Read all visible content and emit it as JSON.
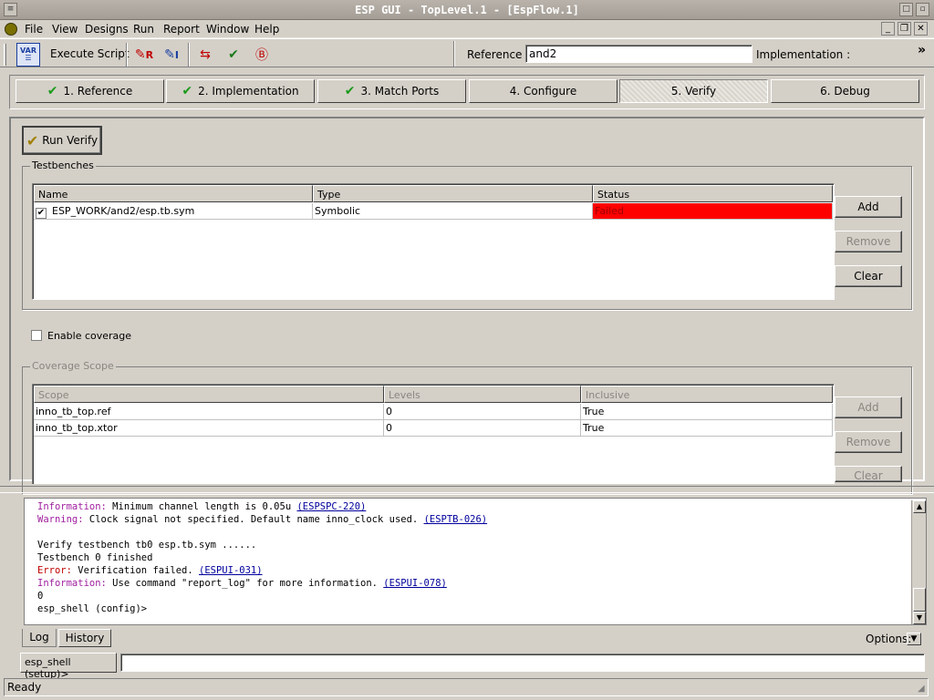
{
  "window": {
    "title": "ESP GUI - TopLevel.1 - [EspFlow.1]"
  },
  "menu": [
    "File",
    "View",
    "Designs",
    "Run",
    "Report",
    "Window",
    "Help"
  ],
  "toolbar": {
    "execute_script": "Execute Script",
    "var_icon_text": "VAR",
    "reference_label": "Reference :",
    "reference_value": "and2",
    "implementation_label": "Implementation :",
    "overflow": "»"
  },
  "steps": [
    {
      "label": "1. Reference",
      "done": true
    },
    {
      "label": "2. Implementation",
      "done": true
    },
    {
      "label": "3. Match Ports",
      "done": true
    },
    {
      "label": "4. Configure",
      "done": false
    },
    {
      "label": "5. Verify",
      "done": false,
      "active": true
    },
    {
      "label": "6. Debug",
      "done": false
    }
  ],
  "verify": {
    "run_button": "Run Verify",
    "testbenches": {
      "title": "Testbenches",
      "columns": [
        "Name",
        "Type",
        "Status"
      ],
      "rows": [
        {
          "checked": true,
          "name": "ESP_WORK/and2/esp.tb.sym",
          "type": "Symbolic",
          "status": "Failed"
        }
      ],
      "status_color": "#ff0000",
      "buttons": {
        "add": "Add",
        "remove": "Remove",
        "clear": "Clear"
      }
    },
    "coverage": {
      "enable_label": "Enable coverage",
      "enabled": false,
      "scope_title": "Coverage Scope",
      "columns": [
        "Scope",
        "Levels",
        "Inclusive"
      ],
      "rows": [
        {
          "scope": "inno_tb_top.ref",
          "levels": "0",
          "inclusive": "True"
        },
        {
          "scope": "inno_tb_top.xtor",
          "levels": "0",
          "inclusive": "True"
        }
      ],
      "buttons": {
        "add": "Add",
        "remove": "Remove",
        "clear": "Clear"
      }
    }
  },
  "log": {
    "lines": [
      {
        "label": "Information:",
        "text": " Minimum channel length is 0.05u ",
        "link": "(ESPSPC-220)",
        "kind": "info"
      },
      {
        "label": "Warning:",
        "text": " Clock signal not specified. Default name inno_clock used. ",
        "link": "(ESPTB-026)",
        "kind": "warn"
      },
      {
        "label": "",
        "text": "",
        "link": "",
        "kind": "plain"
      },
      {
        "label": "",
        "text": "Verify testbench tb0 esp.tb.sym ......",
        "link": "",
        "kind": "plain"
      },
      {
        "label": "",
        "text": "Testbench 0 finished",
        "link": "",
        "kind": "plain"
      },
      {
        "label": "Error:",
        "text": " Verification failed. ",
        "link": "(ESPUI-031)",
        "kind": "err"
      },
      {
        "label": "Information:",
        "text": " Use command \"report_log\" for more information. ",
        "link": "(ESPUI-078)",
        "kind": "info"
      },
      {
        "label": "",
        "text": "0",
        "link": "",
        "kind": "plain"
      },
      {
        "label": "",
        "text": "esp_shell (config)>",
        "link": "",
        "kind": "plain"
      }
    ],
    "tabs": [
      "Log",
      "History"
    ],
    "options_label": "Options:"
  },
  "shell": {
    "prompt": "esp_shell (setup)>",
    "input_value": ""
  },
  "status": {
    "text": "Ready"
  }
}
